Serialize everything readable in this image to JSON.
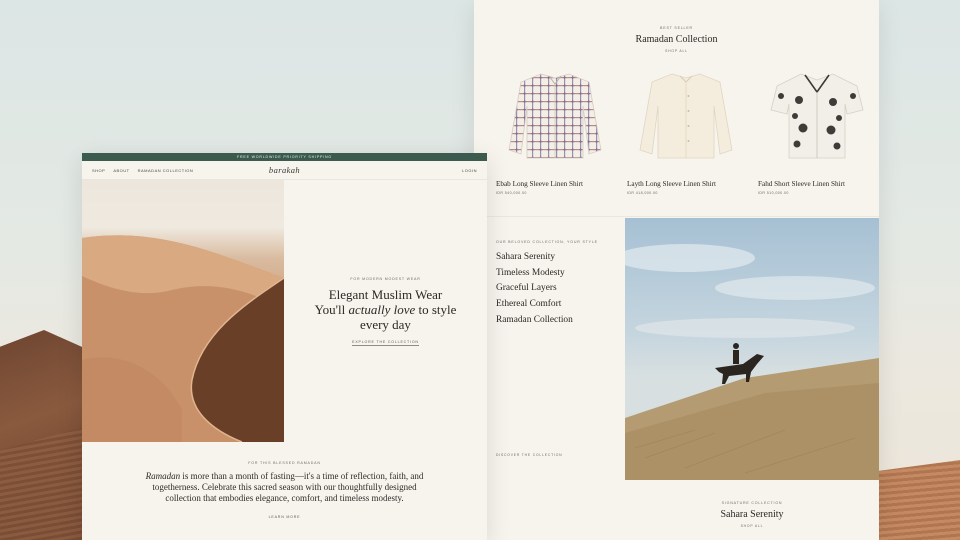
{
  "background": {
    "sky_color": "#dce6e5",
    "dune_color": "#8a5a3e"
  },
  "left_page": {
    "promo_bar": "FREE WORLDWIDE PRIORITY SHIPPING",
    "nav": {
      "links": [
        "SHOP",
        "ABOUT",
        "RAMADAN COLLECTION"
      ],
      "brand": "barakah",
      "login": "LOGIN"
    },
    "hero": {
      "eyebrow": "FOR MODERN MODEST WEAR",
      "title_line1": "Elegant Muslim Wear",
      "title_pre": "You'll ",
      "title_em": "actually love",
      "title_post": " to style",
      "title_line3": "every day",
      "cta": "EXPLORE THE COLLECTION"
    },
    "story": {
      "eyebrow": "FOR THIS BLESSED RAMADAN",
      "text_em": "Ramadan",
      "text_rest": " is more than a month of fasting—it's a time of reflection, faith, and togetherness. Celebrate this sacred season with our thoughtfully designed collection that embodies elegance, comfort, and timeless modesty.",
      "cta": "LEARN MORE"
    }
  },
  "right_page": {
    "best_sellers": {
      "eyebrow": "BEST SELLER",
      "title": "Ramadan Collection",
      "link": "SHOP ALL"
    },
    "products": [
      {
        "name": "Ebab Long Sleeve Linen Shirt",
        "price": "IDR 540,000.00",
        "icon": "patterned-shirt"
      },
      {
        "name": "Layth Long Sleeve Linen Shirt",
        "price": "IDR 418,000.00",
        "icon": "plain-shirt"
      },
      {
        "name": "Fahd Short Sleeve Linen Shirt",
        "price": "IDR 510,000.00",
        "icon": "embroidered-short-sleeve-shirt"
      }
    ],
    "collections": {
      "eyebrow": "OUR BELOVED COLLECTION, YOUR STYLE",
      "items": [
        "Sahara Serenity",
        "Timeless Modesty",
        "Graceful Layers",
        "Ethereal Comfort",
        "Ramadan Collection"
      ],
      "cta": "DISCOVER THE COLLECTION"
    },
    "feature": {
      "eyebrow": "SIGNATURE COLLECTION",
      "title": "Sahara Serenity",
      "link": "SHOP ALL"
    }
  }
}
